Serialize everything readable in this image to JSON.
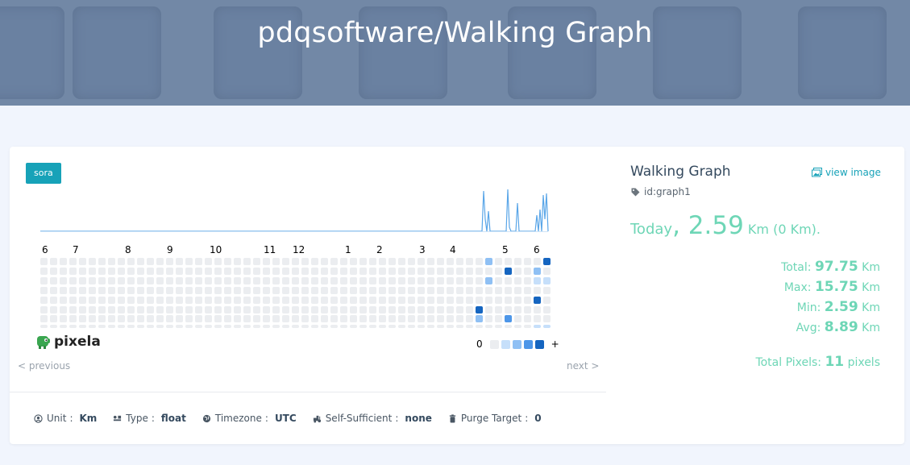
{
  "header": {
    "title": "pdqsoftware/Walking Graph"
  },
  "user_badge": "sora",
  "heatmap": {
    "hour_labels": [
      "6",
      "7",
      "8",
      "9",
      "10",
      "11",
      "12",
      "1",
      "2",
      "3",
      "4",
      "5",
      "6"
    ],
    "rows": 7,
    "cols": 53,
    "levels": [
      "#ebedf0",
      "#c6dffa",
      "#8fc0f4",
      "#4d96e8",
      "#1565c0"
    ],
    "active_cells": [
      {
        "col": 46,
        "row": 0,
        "level": 2
      },
      {
        "col": 52,
        "row": 0,
        "level": 4
      },
      {
        "col": 48,
        "row": 1,
        "level": 4
      },
      {
        "col": 51,
        "row": 1,
        "level": 2
      },
      {
        "col": 46,
        "row": 2,
        "level": 2
      },
      {
        "col": 51,
        "row": 2,
        "level": 1
      },
      {
        "col": 52,
        "row": 2,
        "level": 1
      },
      {
        "col": 51,
        "row": 4,
        "level": 4
      },
      {
        "col": 45,
        "row": 5,
        "level": 4
      },
      {
        "col": 45,
        "row": 6,
        "level": 2
      },
      {
        "col": 48,
        "row": 6,
        "level": 3
      },
      {
        "col": 51,
        "row": 7,
        "level": 1
      },
      {
        "col": 52,
        "row": 7,
        "level": 1
      }
    ]
  },
  "logo_text": "pixela",
  "legend": {
    "min_label": "0",
    "max_label": "+"
  },
  "nav": {
    "previous": "< previous",
    "next": "next >"
  },
  "meta": {
    "unit_label": "Unit",
    "unit_value": "Km",
    "type_label": "Type",
    "type_value": "float",
    "timezone_label": "Timezone",
    "timezone_value": "UTC",
    "self_sufficient_label": "Self-Sufficient",
    "self_sufficient_value": "none",
    "purge_label": "Purge Target",
    "purge_value": "0"
  },
  "graph": {
    "name": "Walking Graph",
    "view_image": "view image",
    "id": "id:graph1"
  },
  "today": {
    "label": "Today",
    "value": "2.59",
    "unit": "Km (0 Km)."
  },
  "stats": {
    "total_label": "Total:",
    "total_value": "97.75",
    "max_label": "Max:",
    "max_value": "15.75",
    "min_label": "Min:",
    "min_value": "2.59",
    "avg_label": "Avg:",
    "avg_value": "8.89",
    "unit": "Km"
  },
  "total_pixels": {
    "label": "Total Pixels:",
    "value": "11",
    "unit": "pixels"
  },
  "colors": {
    "accent": "#17a2b8",
    "stat_green": "#6ed6b6",
    "spark": "#5aa6e8"
  }
}
